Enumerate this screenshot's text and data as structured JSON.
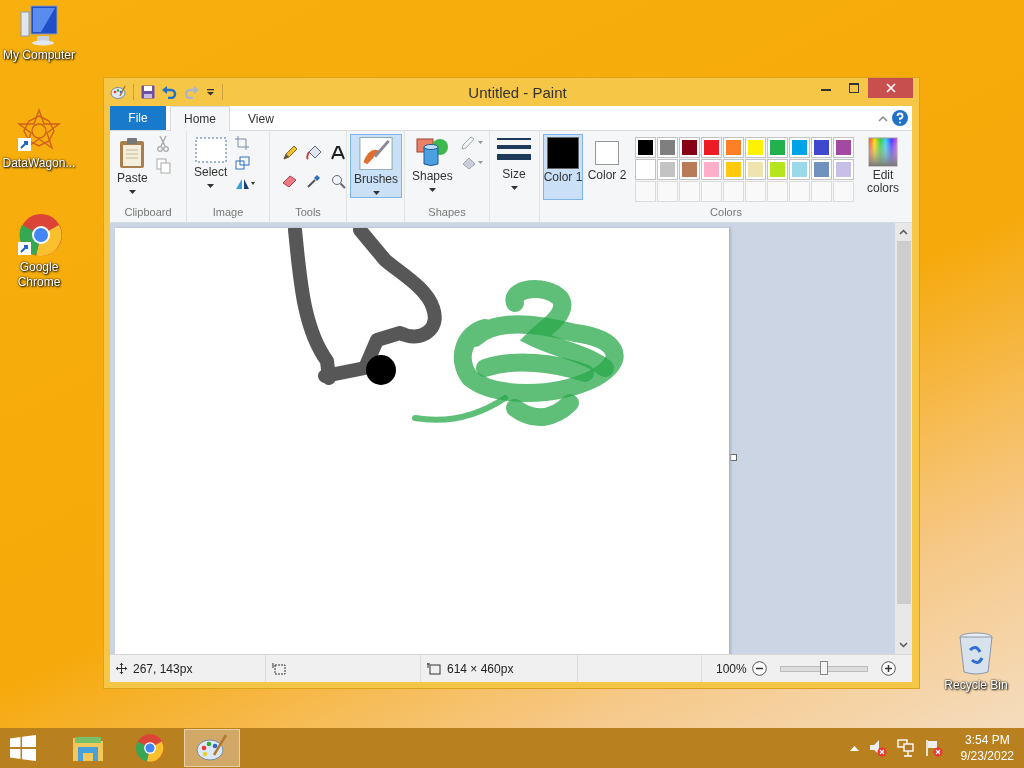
{
  "desktop_icons": [
    {
      "kind": "computer",
      "label": "My Computer"
    },
    {
      "kind": "star",
      "label": "DataWagon..."
    },
    {
      "kind": "chrome",
      "label": "Google Chrome"
    }
  ],
  "recycle_bin": {
    "label": "Recycle Bin"
  },
  "window": {
    "title": "Untitled - Paint"
  },
  "ribbon_tabs": [
    {
      "kind": "file",
      "label": "File",
      "selected": false
    },
    {
      "kind": "tab",
      "label": "Home",
      "selected": true
    },
    {
      "kind": "tab",
      "label": "View",
      "selected": false
    }
  ],
  "groups": {
    "clipboard": {
      "label": "Clipboard",
      "paste": "Paste"
    },
    "image": {
      "label": "Image",
      "select": "Select"
    },
    "tools": {
      "label": "Tools"
    },
    "brushes": {
      "label": "Brushes",
      "selected": true
    },
    "shapes": {
      "label": "Shapes",
      "button": "Shapes"
    },
    "size": {
      "label": "Size"
    },
    "colors": {
      "label": "Colors",
      "edit": "Edit colors",
      "current": [
        {
          "label": "Color 1",
          "color": "#000000",
          "selected": true
        },
        {
          "label": "Color 2",
          "color": "#ffffff",
          "selected": false
        }
      ],
      "palette": [
        {
          "color": "#000000"
        },
        {
          "color": "#7f7f7f"
        },
        {
          "color": "#880015"
        },
        {
          "color": "#ed1c24"
        },
        {
          "color": "#ff7f27"
        },
        {
          "color": "#fff200"
        },
        {
          "color": "#22b14c"
        },
        {
          "color": "#00a2e8"
        },
        {
          "color": "#3f48cc"
        },
        {
          "color": "#a349a4"
        },
        {
          "color": "#ffffff"
        },
        {
          "color": "#c3c3c3"
        },
        {
          "color": "#b97a57"
        },
        {
          "color": "#ffaec9"
        },
        {
          "color": "#ffc90e"
        },
        {
          "color": "#efe4b0"
        },
        {
          "color": "#b5e61d"
        },
        {
          "color": "#99d9ea"
        },
        {
          "color": "#7092be"
        },
        {
          "color": "#c8bfe7"
        }
      ]
    }
  },
  "status_bar": {
    "position": "267, 143px",
    "canvas_size": "614 × 460px",
    "zoom": "100%",
    "zoom_level": {
      "level": 0.5
    }
  },
  "taskbar": {
    "apps": [
      {
        "kind": "explorer",
        "selected": false
      },
      {
        "kind": "chrome",
        "selected": false
      },
      {
        "kind": "paint",
        "selected": true
      }
    ],
    "time": "3:54 PM",
    "date": "9/23/2022"
  }
}
